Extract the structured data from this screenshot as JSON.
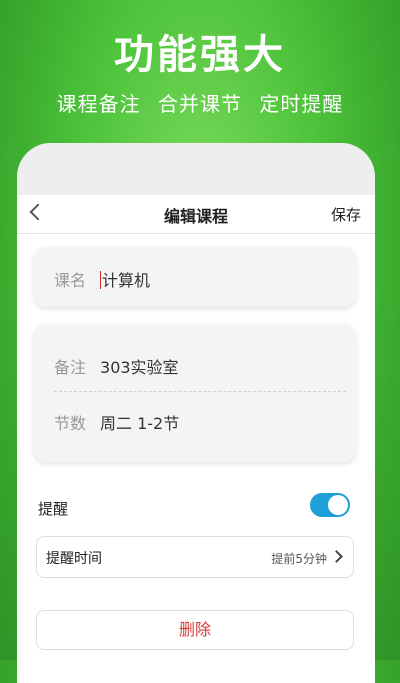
{
  "hero": {
    "title": "功能强大",
    "features": [
      "课程备注",
      "合并课节",
      "定时提醒"
    ]
  },
  "nav": {
    "back_icon": "chevron-left-icon",
    "title": "编辑课程",
    "save_label": "保存"
  },
  "course": {
    "name_label": "课名",
    "name_value": "计算机",
    "note_label": "备注",
    "note_value": "303实验室",
    "section_label": "节数",
    "section_value": "周二 1-2节"
  },
  "reminder": {
    "label": "提醒",
    "enabled": true,
    "toggle_color": "#1ea0d7",
    "time_label": "提醒时间",
    "time_value": "提前5分钟"
  },
  "delete_label": "删除",
  "colors": {
    "brand_green": "#4cc23a",
    "delete_red": "#d33a3a"
  }
}
